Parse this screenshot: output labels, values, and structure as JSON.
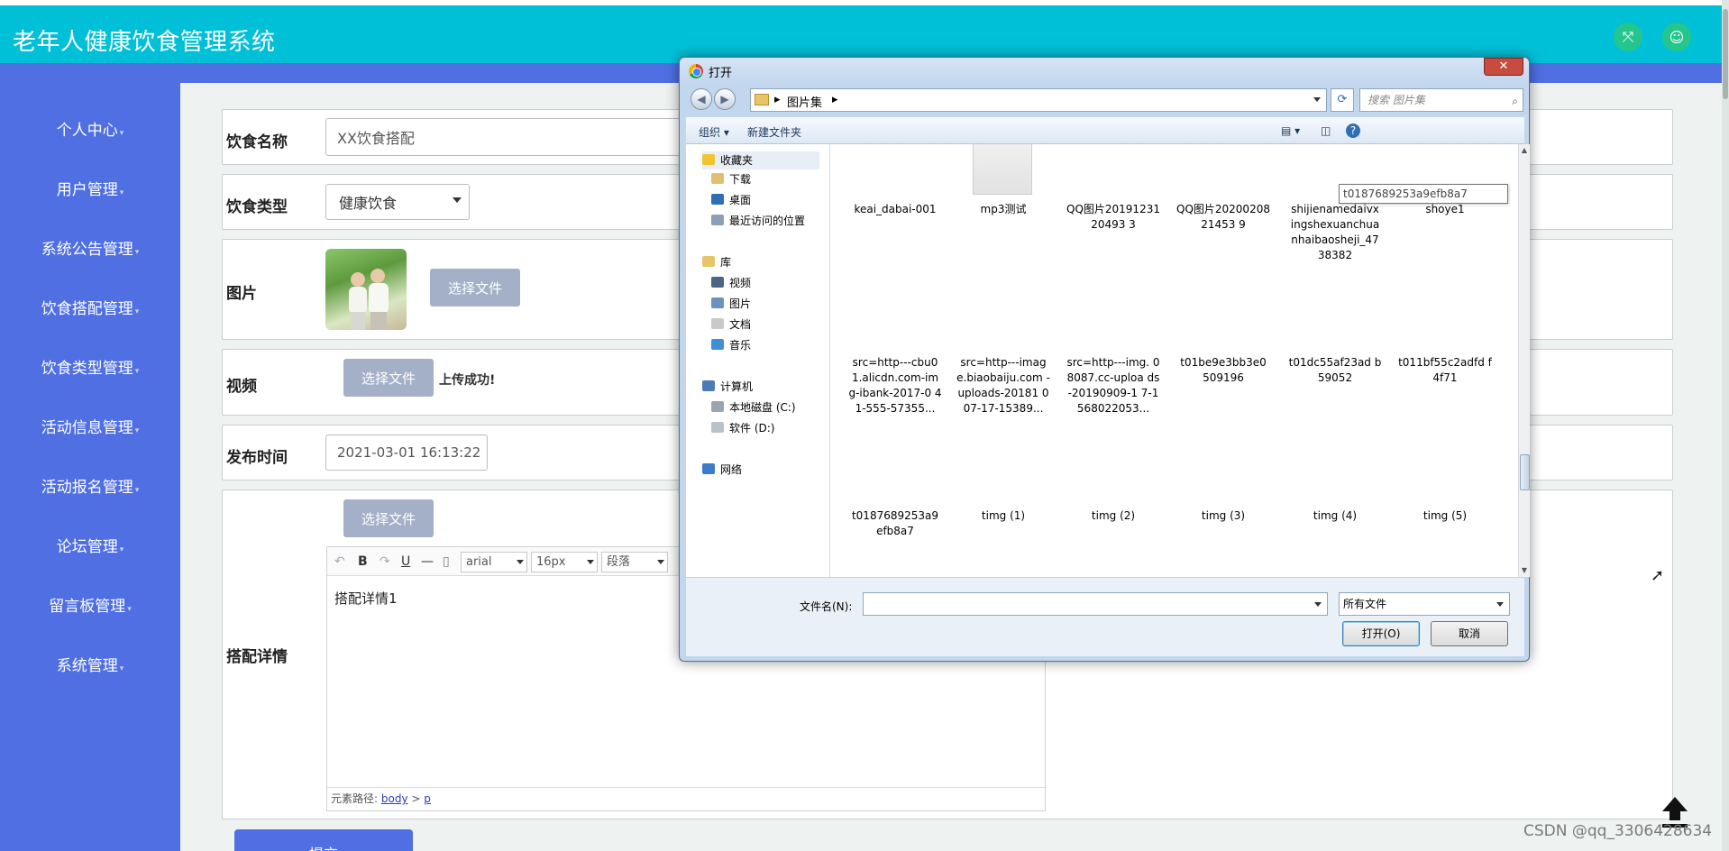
{
  "app": {
    "title": "老年人健康饮食管理系统"
  },
  "header": {
    "fullscreen_icon": "expand-icon",
    "user_icon": "user-icon"
  },
  "sidebar": {
    "items": [
      {
        "label": "个人中心"
      },
      {
        "label": "用户管理"
      },
      {
        "label": "系统公告管理"
      },
      {
        "label": "饮食搭配管理"
      },
      {
        "label": "饮食类型管理"
      },
      {
        "label": "活动信息管理"
      },
      {
        "label": "活动报名管理"
      },
      {
        "label": "论坛管理"
      },
      {
        "label": "留言板管理"
      },
      {
        "label": "系统管理"
      }
    ],
    "caret": "▾"
  },
  "form": {
    "name": {
      "label": "饮食名称",
      "value": "XX饮食搭配"
    },
    "type": {
      "label": "饮食类型",
      "value": "健康饮食"
    },
    "image": {
      "label": "图片",
      "button": "选择文件"
    },
    "video": {
      "label": "视频",
      "button": "选择文件",
      "status": "上传成功!"
    },
    "publish_time": {
      "label": "发布时间",
      "value": "2021-03-01 16:13:22"
    },
    "detail": {
      "label": "搭配详情",
      "button": "选择文件",
      "toolbar": {
        "bold": "B",
        "underline": "U",
        "hr": "—",
        "font": "arial",
        "size": "16px",
        "paragraph": "段落"
      },
      "content": "搭配详情1",
      "path_label": "元素路径:",
      "path_body": "body",
      "path_sep": ">",
      "path_p": "p"
    },
    "submit": "提交"
  },
  "watermark": "CSDN @qq_3306428634",
  "dialog": {
    "title": "打开",
    "close": "✕",
    "path": [
      "图片集"
    ],
    "search_placeholder": "搜索 图片集",
    "toolbar": {
      "organize": "组织 ▾",
      "new_folder": "新建文件夹"
    },
    "nav": [
      {
        "label": "收藏夹",
        "icon": "star-icon",
        "color": "#f2c230"
      },
      {
        "label": "下载",
        "icon": "downloads-icon",
        "color": "#e0c070"
      },
      {
        "label": "桌面",
        "icon": "desktop-icon",
        "color": "#2f6fb5"
      },
      {
        "label": "最近访问的位置",
        "icon": "recent-icon",
        "color": "#8aa0b8"
      },
      {
        "label": "库",
        "icon": "library-icon",
        "color": "#e7c46a"
      },
      {
        "label": "视频",
        "icon": "video-icon",
        "color": "#4c6585"
      },
      {
        "label": "图片",
        "icon": "pictures-icon",
        "color": "#6d93bd"
      },
      {
        "label": "文档",
        "icon": "documents-icon",
        "color": "#c9c9c9"
      },
      {
        "label": "音乐",
        "icon": "music-icon",
        "color": "#3d8fd6"
      },
      {
        "label": "计算机",
        "icon": "computer-icon",
        "color": "#4d7bb5"
      },
      {
        "label": "本地磁盘 (C:)",
        "icon": "disk-icon",
        "color": "#9aa5b1"
      },
      {
        "label": "软件 (D:)",
        "icon": "disk-icon",
        "color": "#b9c2cb"
      },
      {
        "label": "网络",
        "icon": "network-icon",
        "color": "#3a7dc9"
      }
    ],
    "files_row1": [
      "keai_dabai-001",
      "mp3测试",
      "QQ图片2019123120493 3",
      "QQ图片2020020821453 9",
      "shijienamedaivx ingshexuanchua nhaibaosheji_47 38382",
      "shoye1"
    ],
    "files_row2": [
      "src=http---cbu0 1.alicdn.com-im g-ibank-2017-0 41-555-57355...",
      "src=http---imag e.biaobaiju.com -uploads-20181 007-17-15389...",
      "src=http---img. 08087.cc-uploa ds-20190909-1 7-1568022053...",
      "t01be9e3bb3e0 509196",
      "t01dc55af23ad b59052",
      "t011bf55c2adfd f4f71"
    ],
    "files_row3": [
      "t0187689253a9 efb8a7",
      "timg (1)",
      "timg (2)",
      "timg (3)",
      "timg (4)",
      "timg (5)"
    ],
    "tooltip": "t0187689253a9efb8a7",
    "filename_label": "文件名(N):",
    "filename_value": "",
    "filetype": "所有文件",
    "open": "打开(O)",
    "cancel": "取消"
  }
}
